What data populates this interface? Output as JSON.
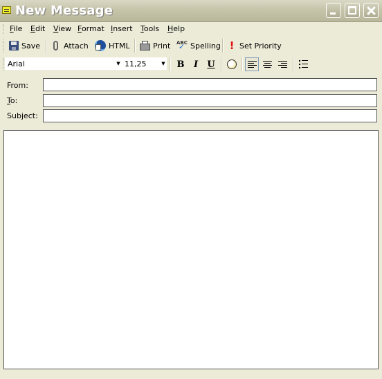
{
  "window": {
    "title": "New Message"
  },
  "menu": [
    {
      "label": "File",
      "accel": "F",
      "rest": "ile"
    },
    {
      "label": "Edit",
      "accel": "E",
      "rest": "dit"
    },
    {
      "label": "View",
      "accel": "V",
      "rest": "iew"
    },
    {
      "label": "Format",
      "accel": "F",
      "rest": "ormat"
    },
    {
      "label": "Insert",
      "accel": "I",
      "rest": "nsert"
    },
    {
      "label": "Tools",
      "accel": "T",
      "rest": "ools"
    },
    {
      "label": "Help",
      "accel": "H",
      "rest": "elp"
    }
  ],
  "toolbar": {
    "save": {
      "label": "Save",
      "icon": "save-icon"
    },
    "attach": {
      "label": "Attach",
      "icon": "paperclip-icon"
    },
    "html": {
      "label": "HTML",
      "icon": "html-globe-icon"
    },
    "print": {
      "label": "Print",
      "icon": "printer-icon"
    },
    "spelling": {
      "label": "Spelling",
      "icon": "spellcheck-icon"
    },
    "priority": {
      "label": "Set Priority",
      "icon": "exclamation-icon"
    }
  },
  "format": {
    "font_name": "Arial",
    "font_size": "11,25",
    "bold": "B",
    "italic": "I",
    "underline": "U",
    "effects_icon": "text-effects-icon",
    "align_left_active": true
  },
  "fields": {
    "from": {
      "label": "From:",
      "accel": "F",
      "rest": "rom:",
      "value": ""
    },
    "to": {
      "label": "To:",
      "accel": "T",
      "rest": "o:",
      "value": ""
    },
    "subject": {
      "label": "Subject:",
      "accel": "S",
      "rest": "ubject:",
      "value": ""
    }
  },
  "body": {
    "text": ""
  },
  "colors": {
    "chrome": "#ecebd8",
    "titlebar": "#c6c4a9",
    "border": "#555555"
  }
}
